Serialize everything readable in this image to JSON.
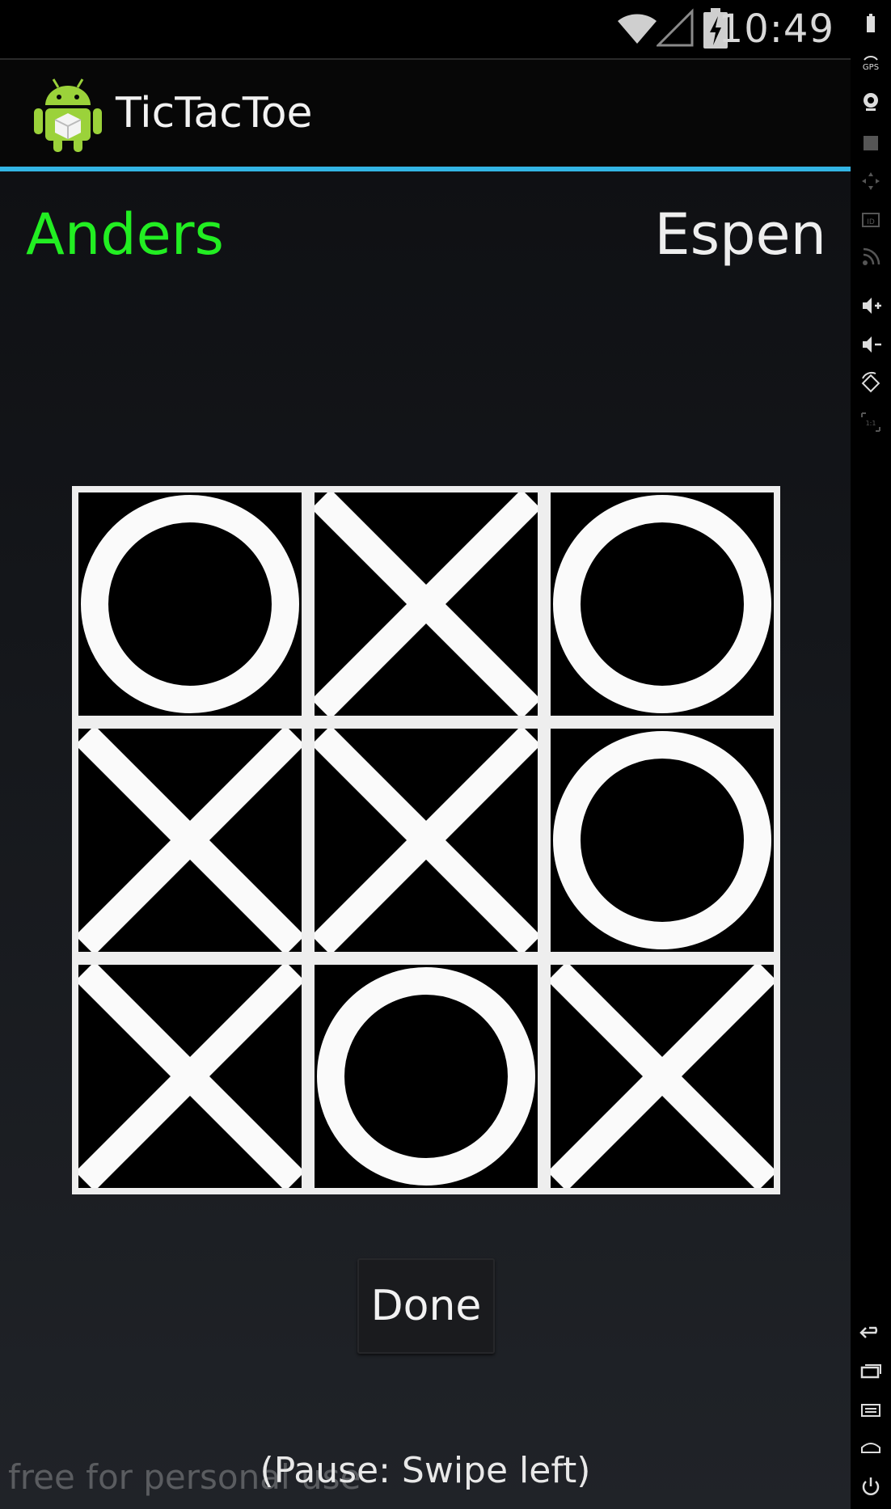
{
  "status_bar": {
    "time": "10:49",
    "icons": [
      "wifi-icon",
      "signal-icon",
      "battery-charging-icon"
    ]
  },
  "action_bar": {
    "title": "TicTacToe",
    "icon": "android-robot-icon",
    "underline_color": "#33b5e5"
  },
  "players": {
    "player1": {
      "name": "Anders",
      "color": "#22ee22",
      "active": true
    },
    "player2": {
      "name": "Espen",
      "color": "#eeeeee",
      "active": false
    }
  },
  "board": {
    "cells": [
      "O",
      "X",
      "O",
      "X",
      "X",
      "O",
      "X",
      "O",
      "X"
    ]
  },
  "done_button": {
    "label": "Done"
  },
  "hint": "(Pause: Swipe left)",
  "watermark": "free for personal use",
  "side_panel": {
    "icons": [
      "battery-icon",
      "gps-icon",
      "camera-icon",
      "clapper-icon",
      "dpad-icon",
      "id-icon",
      "rss-icon",
      "volume-up-icon",
      "volume-down-icon",
      "rotate-icon",
      "scale-icon",
      "back-icon",
      "recent-apps-icon",
      "menu-icon",
      "home-icon",
      "power-icon"
    ]
  }
}
